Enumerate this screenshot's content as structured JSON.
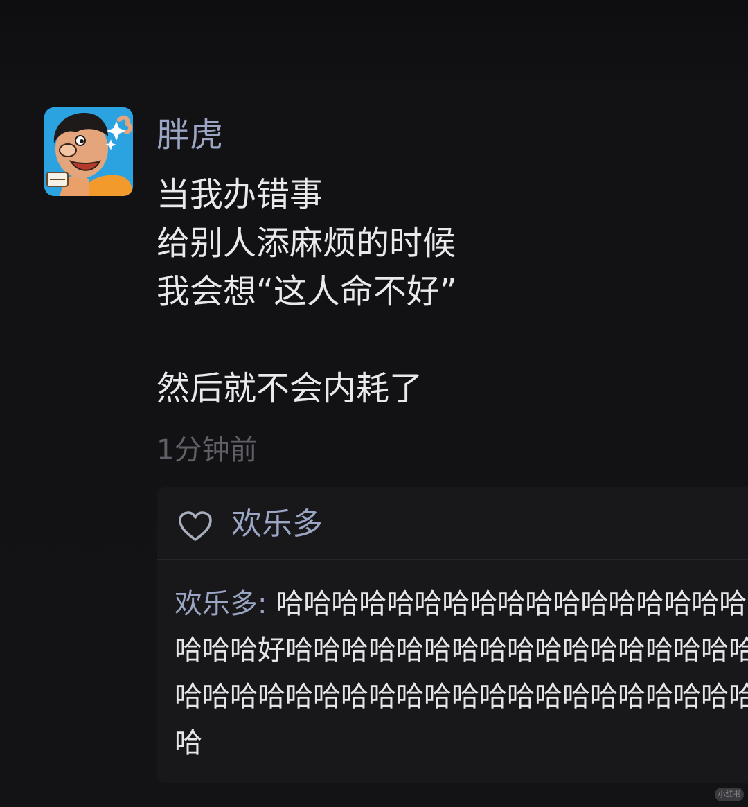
{
  "post": {
    "author": "胖虎",
    "lines": [
      "当我办错事",
      "给别人添麻烦的时候",
      "我会想“这人命不好”"
    ],
    "last_line": "然后就不会内耗了",
    "time": "1分钟前"
  },
  "likes": {
    "icon": "heart-outline-icon",
    "names": "欢乐多"
  },
  "comment": {
    "author_label": "欢乐多:",
    "text": " 哈哈哈哈哈哈哈哈哈哈哈哈哈哈哈哈哈哈哈哈哈好哈哈哈哈哈哈哈哈哈哈哈哈哈哈哈哈哈哈哈哈哈哈哈哈哈哈哈哈哈哈哈哈哈哈哈哈哈哈哈"
  },
  "watermark": {
    "text": "小红书"
  },
  "colors": {
    "background": "#121214",
    "name_blue": "#9aa6c4",
    "text": "#e9e9ec",
    "muted": "#5f6067",
    "panel": "#18181b"
  }
}
